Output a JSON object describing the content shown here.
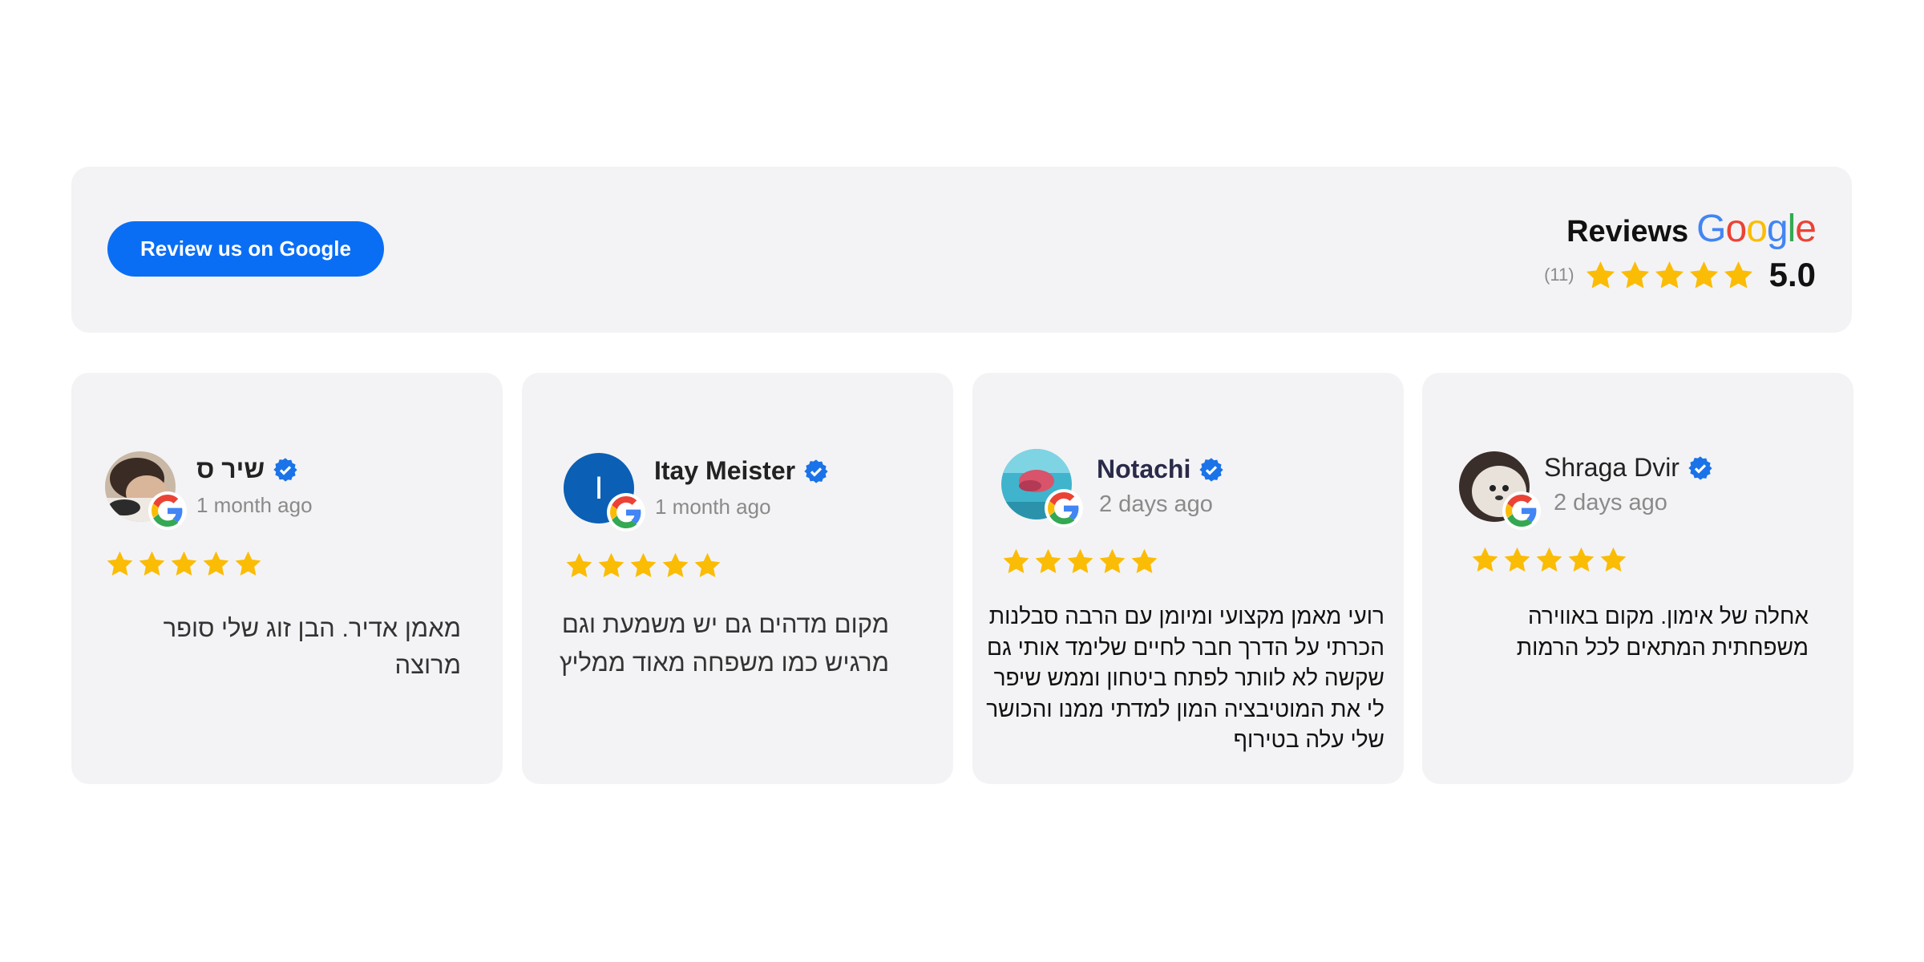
{
  "header": {
    "button_label": "Review us on Google",
    "reviews_label": "Reviews",
    "google_letters": [
      {
        "ch": "G",
        "color": "#4285F4"
      },
      {
        "ch": "o",
        "color": "#EA4335"
      },
      {
        "ch": "o",
        "color": "#FBBC05"
      },
      {
        "ch": "g",
        "color": "#4285F4"
      },
      {
        "ch": "l",
        "color": "#34A853"
      },
      {
        "ch": "e",
        "color": "#EA4335"
      }
    ],
    "count": "(11)",
    "stars": 5,
    "score": "5.0"
  },
  "colors": {
    "accent": "#0a6ef5",
    "star": "#FBBC05",
    "verified": "#1a73e8",
    "card_bg": "#f3f3f5"
  },
  "reviews": [
    {
      "name": "שיר ס",
      "time": "1 month ago",
      "rating": 5,
      "text": "מאמן אדיר. הבן זוג שלי סופר מרוצה",
      "avatar": "photo-person"
    },
    {
      "name": "Itay Meister",
      "time": "1 month ago",
      "rating": 5,
      "text": "מקום מדהים גם יש משמעת וגם מרגיש כמו משפחה מאוד ממליץ",
      "avatar_initial": "I",
      "avatar": "initial"
    },
    {
      "name": "Notachi",
      "time": "2 days ago",
      "rating": 5,
      "text": "רועי מאמן מקצועי ומיומן עם הרבה סבלנות הכרתי על הדרך חבר לחיים שלימד אותי גם שקשה לא לוותר לפתח ביטחון וממש שיפר לי את המוטיבציה המון למדתי ממנו והכושר שלי עלה בטירוף",
      "avatar": "photo-underwater"
    },
    {
      "name": "Shraga Dvir",
      "time": "2 days ago",
      "rating": 5,
      "text": "אחלה של אימון. מקום באווירה משפחתית המתאים לכל הרמות",
      "avatar": "photo-dog"
    }
  ]
}
